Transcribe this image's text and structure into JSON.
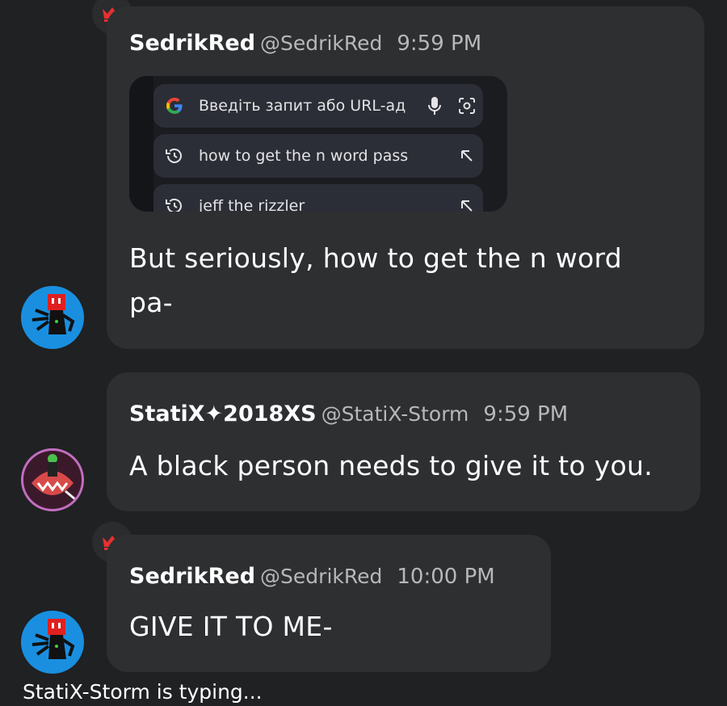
{
  "messages": [
    {
      "name": "SedrikRed",
      "handle": "@SedrikRed",
      "time": "9:59 PM",
      "text_line1": "But seriously, how to get the n word",
      "text_line2": "pa-",
      "attachment": {
        "search_placeholder": "Введіть запит або URL-ад",
        "history": [
          "how to get the n word pass",
          "jeff the rizzler"
        ]
      }
    },
    {
      "name": "StatiX✦2018XS",
      "handle": "@StatiX-Storm",
      "time": "9:59 PM",
      "text": "A black person needs to give it to you."
    },
    {
      "name": "SedrikRed",
      "handle": "@SedrikRed",
      "time": "10:00 PM",
      "text": "GIVE IT TO ME-"
    }
  ],
  "typing_indicator": "StatiX-Storm is typing...",
  "colors": {
    "background": "#1f2122",
    "bubble": "#2d2f31",
    "crown": "#e53030",
    "avatar_blue": "#1a8fe0",
    "avatar_red": "#e02020"
  },
  "icons": [
    "crown-icon",
    "google-logo-icon",
    "microphone-icon",
    "lens-icon",
    "history-icon",
    "arrow-up-left-icon"
  ]
}
